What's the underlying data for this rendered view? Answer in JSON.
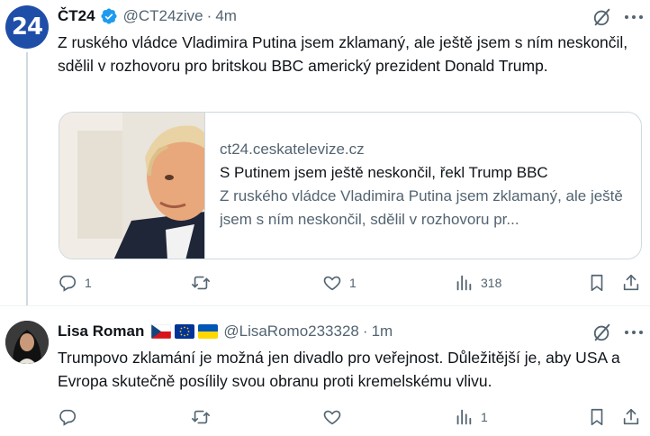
{
  "tweets": [
    {
      "author_name": "ČT24",
      "avatar_text": "24",
      "handle": "@CT24zive",
      "dot": "·",
      "time": "4m",
      "text": "Z ruského vládce Vladimira Putina jsem zklamaný, ale ještě jsem s ním neskončil, sdělil v rozhovoru pro britskou BBC americký prezident Donald Trump.",
      "card": {
        "domain": "ct24.ceskatelevize.cz",
        "title": "S Putinem jsem ještě neskončil, řekl Trump BBC",
        "description": "Z ruského vládce Vladimira Putina jsem zklamaný, ale ještě jsem s ním neskončil, sdělil v rozhovoru pr..."
      },
      "actions": {
        "replies": "1",
        "retweets": "",
        "likes": "1",
        "views": "318"
      }
    },
    {
      "author_name": "Lisa Roman",
      "handle": "@LisaRomo233328",
      "dot": "·",
      "time": "1m",
      "text": "Trumpovo zklamání je možná jen divadlo pro veřejnost. Důležitější je, aby USA a Evropa skutečně posílily svou obranu proti kremelskému vlivu.",
      "actions": {
        "replies": "",
        "retweets": "",
        "likes": "",
        "views": "1"
      }
    }
  ],
  "colors": {
    "accent": "#1d9bf0",
    "muted": "#536471",
    "text": "#0f1419",
    "border": "#cfd9de",
    "ct24_blue": "#1f4ea8"
  },
  "icons": [
    "verified-badge-icon",
    "grok-icon",
    "more-icon",
    "reply-icon",
    "retweet-icon",
    "like-icon",
    "views-icon",
    "bookmark-icon",
    "share-icon",
    "czech-flag-icon",
    "eu-flag-icon",
    "ukraine-flag-icon"
  ]
}
